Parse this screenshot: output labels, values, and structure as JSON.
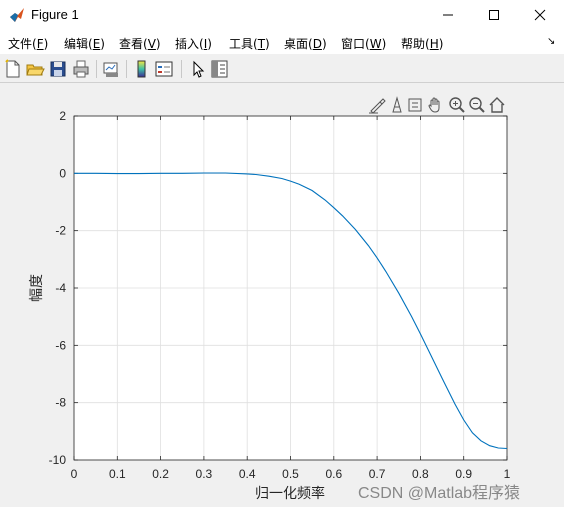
{
  "window": {
    "title": "Figure 1"
  },
  "menu": [
    {
      "label": "文件(",
      "key": "F",
      "close": ")"
    },
    {
      "label": "编辑(",
      "key": "E",
      "close": ")"
    },
    {
      "label": "查看(",
      "key": "V",
      "close": ")"
    },
    {
      "label": "插入(",
      "key": "I",
      "close": ")"
    },
    {
      "label": "工具(",
      "key": "T",
      "close": ")"
    },
    {
      "label": "桌面(",
      "key": "D",
      "close": ")"
    },
    {
      "label": "窗口(",
      "key": "W",
      "close": ")"
    },
    {
      "label": "帮助(",
      "key": "H",
      "close": ")"
    }
  ],
  "toolbar_icons": [
    "new-figure-icon",
    "open-file-icon",
    "save-icon",
    "print-icon",
    "link-plot-icon",
    "insert-colorbar-icon",
    "insert-legend-icon",
    "edit-plot-icon",
    "property-inspector-icon"
  ],
  "axes_tools": [
    "brush-icon",
    "data-tips-icon",
    "rotate-icon",
    "pan-icon",
    "zoom-in-icon",
    "zoom-out-icon",
    "restore-view-icon"
  ],
  "watermark": "CSDN @Matlab程序猿",
  "colors": {
    "line": "#0072bd",
    "grid": "#dfdfdf",
    "axes_bg": "#ffffff",
    "figure_bg": "#f0f0f0"
  },
  "chart_data": {
    "type": "line",
    "xlabel": "归一化频率",
    "ylabel": "幅度",
    "xlim": [
      0,
      1
    ],
    "ylim": [
      -10,
      2
    ],
    "xticks": [
      "0",
      "0.1",
      "0.2",
      "0.3",
      "0.4",
      "0.5",
      "0.6",
      "0.7",
      "0.8",
      "0.9",
      "1"
    ],
    "yticks": [
      "2",
      "0",
      "-2",
      "-4",
      "-6",
      "-8",
      "-10"
    ],
    "grid": true,
    "series": [
      {
        "x": [
          0,
          0.05,
          0.1,
          0.15,
          0.2,
          0.25,
          0.3,
          0.35,
          0.4,
          0.42,
          0.45,
          0.48,
          0.5,
          0.52,
          0.55,
          0.58,
          0.6,
          0.62,
          0.65,
          0.68,
          0.7,
          0.72,
          0.75,
          0.78,
          0.8,
          0.82,
          0.85,
          0.88,
          0.9,
          0.92,
          0.94,
          0.96,
          0.98,
          1.0
        ],
        "y": [
          0,
          0,
          -0.01,
          -0.01,
          0,
          0,
          0.01,
          0.01,
          -0.02,
          -0.04,
          -0.1,
          -0.18,
          -0.27,
          -0.38,
          -0.6,
          -0.93,
          -1.2,
          -1.48,
          -1.96,
          -2.52,
          -2.95,
          -3.42,
          -4.18,
          -5.0,
          -5.6,
          -6.22,
          -7.15,
          -8.05,
          -8.6,
          -9.05,
          -9.33,
          -9.5,
          -9.58,
          -9.6
        ]
      }
    ]
  }
}
